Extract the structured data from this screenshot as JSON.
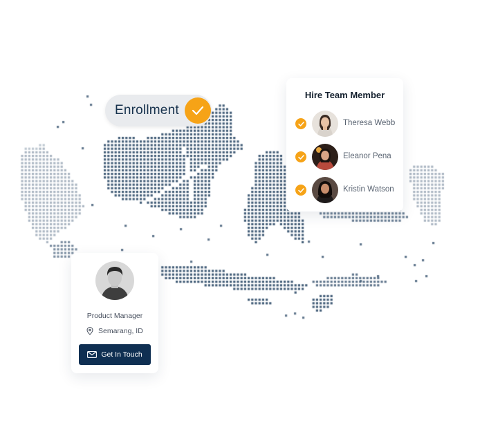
{
  "enrollment": {
    "label": "Enrollment",
    "icon": "check-icon",
    "accent": "#f6a317"
  },
  "hire": {
    "title": "Hire Team Member",
    "members": [
      {
        "name": "Theresa Webb",
        "icon": "check-icon"
      },
      {
        "name": "Eleanor Pena",
        "icon": "check-icon"
      },
      {
        "name": "Kristin Watson",
        "icon": "check-icon"
      }
    ]
  },
  "profile": {
    "role": "Product Manager",
    "location": "Semarang, ID",
    "location_icon": "map-pin-icon",
    "button": "Get In Touch",
    "button_icon": "mail-icon",
    "button_color": "#0f2f52"
  },
  "map": {
    "dot_color": "#46607a"
  }
}
